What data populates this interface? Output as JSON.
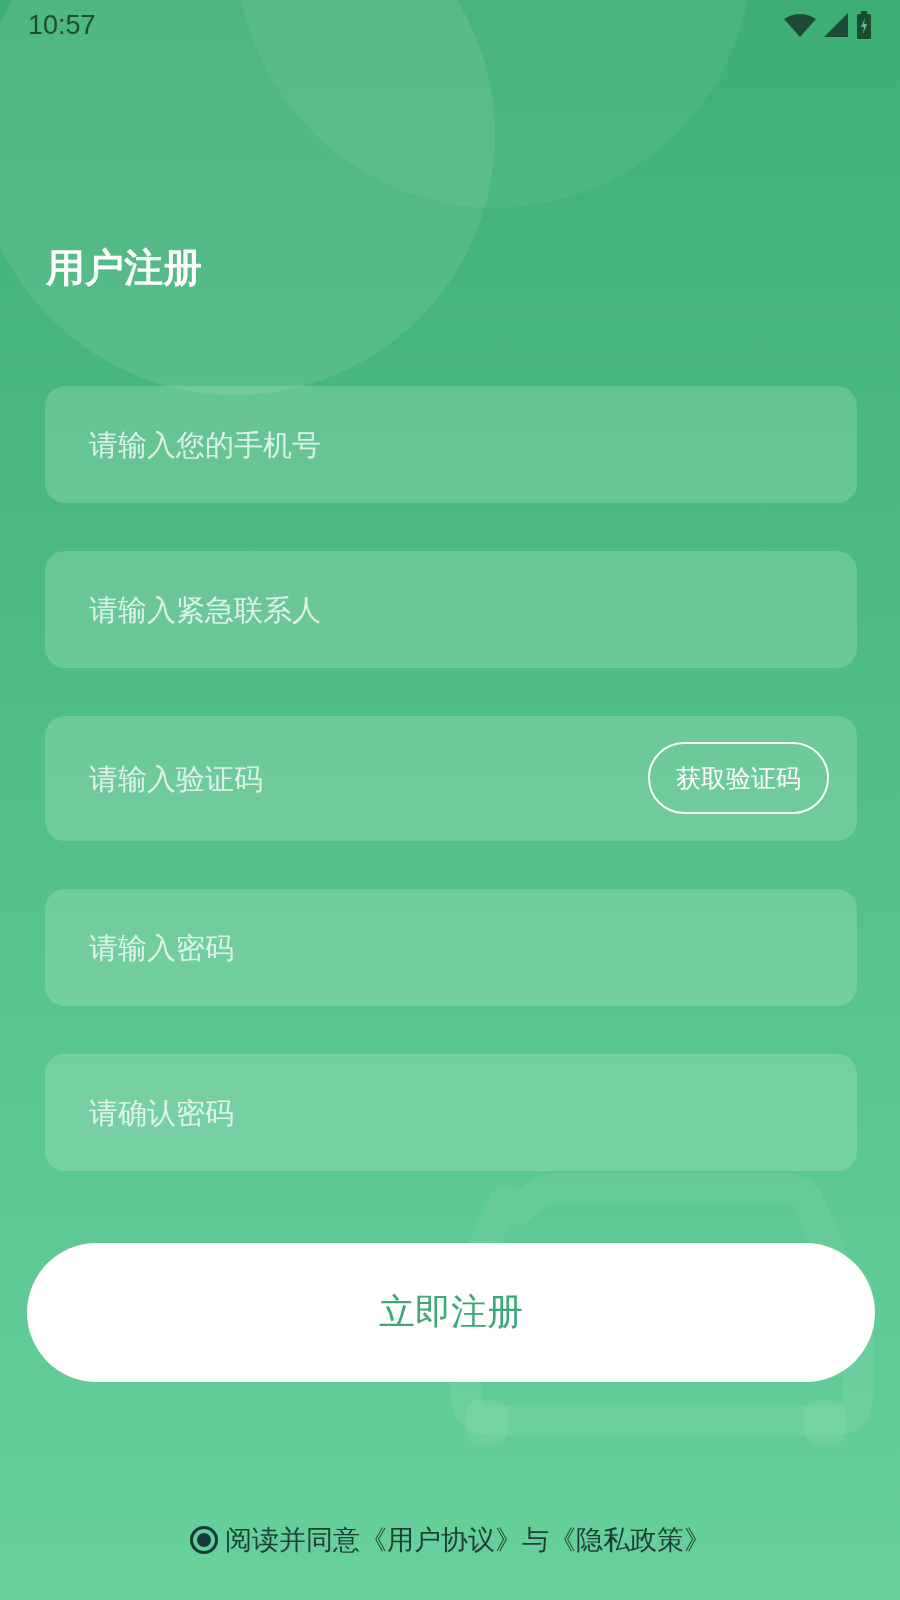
{
  "status_bar": {
    "time": "10:57"
  },
  "title": "用户注册",
  "fields": [
    {
      "placeholder": "请输入您的手机号"
    },
    {
      "placeholder": "请输入紧急联系人"
    },
    {
      "placeholder": "请输入验证码",
      "action": "获取验证码"
    },
    {
      "placeholder": "请输入密码"
    },
    {
      "placeholder": "请确认密码"
    }
  ],
  "submit": "立即注册",
  "agreement": {
    "selected": true,
    "text": "阅读并同意《用户协议》与《隐私政策》"
  }
}
